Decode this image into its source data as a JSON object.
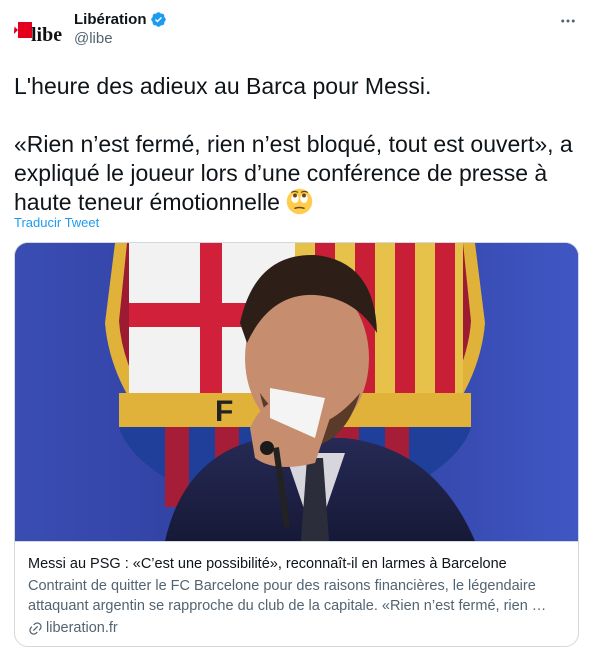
{
  "account": {
    "display_name": "Libération",
    "handle": "@libe",
    "avatar_text": "libe",
    "verified": true
  },
  "tweet": {
    "line1": "L'heure des adieux au Barca pour Messi.",
    "line2": " «Rien n’est fermé, rien n’est bloqué, tout est ouvert», a expliqué le joueur lors d’une conférence de presse à haute teneur émotionnelle",
    "emoji": "rolling-eyes-face",
    "translate_label": "Traducir Tweet"
  },
  "card": {
    "title": "Messi au PSG : «C’est une possibilité», reconnaît-il en larmes à Barcelone",
    "description": "Contraint de quitter le FC Barcelone pour des raisons financières, le légendaire attaquant argentin se rapproche du club de la capitale. «Rien n’est fermé, rien …",
    "domain": "liberation.fr",
    "image_subject": "Messi wiping tears with a tissue in front of FC Barcelona crest"
  },
  "colors": {
    "accent": "#1d9bf0",
    "text": "#0f1419",
    "muted": "#536471",
    "border": "#cfd9de"
  }
}
